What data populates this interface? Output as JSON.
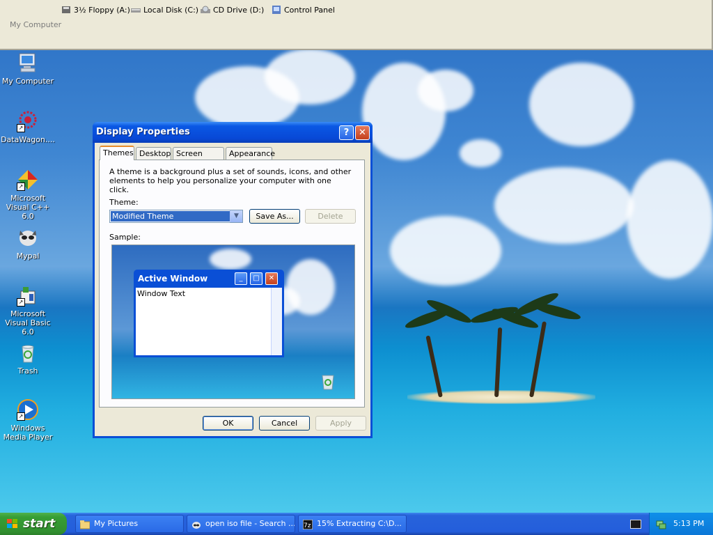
{
  "topbar": {
    "drives": [
      {
        "label": "3½ Floppy (A:)",
        "icon": "floppy-icon"
      },
      {
        "label": "Local Disk (C:)",
        "icon": "hard-disk-icon"
      },
      {
        "label": "CD Drive (D:)",
        "icon": "cd-drive-icon"
      },
      {
        "label": "Control Panel",
        "icon": "control-panel-icon"
      }
    ],
    "title": "My Computer"
  },
  "desktop_icons": [
    {
      "label": "My Computer",
      "icon": "computer-icon"
    },
    {
      "label": "DataWagon....",
      "icon": "datawagon-icon"
    },
    {
      "label": "Microsoft Visual C++ 6.0",
      "icon": "visual-cpp-icon"
    },
    {
      "label": "Mypal",
      "icon": "mypal-icon"
    },
    {
      "label": "Microsoft Visual Basic 6.0",
      "icon": "visual-basic-icon"
    },
    {
      "label": "Trash",
      "icon": "recycle-bin-icon"
    },
    {
      "label": "Windows Media Player",
      "icon": "media-player-icon"
    }
  ],
  "dialog": {
    "title": "Display Properties",
    "help": "?",
    "close": "✕",
    "tabs": [
      "Themes",
      "Desktop",
      "Screen Saver",
      "Appearance"
    ],
    "active_tab": "Themes",
    "description": "A theme is a background plus a set of sounds, icons, and other elements to help you personalize your computer with one click.",
    "theme_label": "Theme:",
    "theme_value": "Modified Theme",
    "save_as": "Save As...",
    "delete": "Delete",
    "sample_label": "Sample:",
    "sample_window_title": "Active Window",
    "sample_window_text": "Window Text",
    "ok": "OK",
    "cancel": "Cancel",
    "apply": "Apply"
  },
  "taskbar": {
    "start": "start",
    "tasks": [
      {
        "label": "My Pictures",
        "icon": "folder-icon"
      },
      {
        "label": "open iso file - Search ...",
        "icon": "mypal-icon"
      },
      {
        "label": "15% Extracting C:\\D...",
        "icon": "7zip-icon"
      }
    ],
    "clock": "5:13 PM"
  }
}
